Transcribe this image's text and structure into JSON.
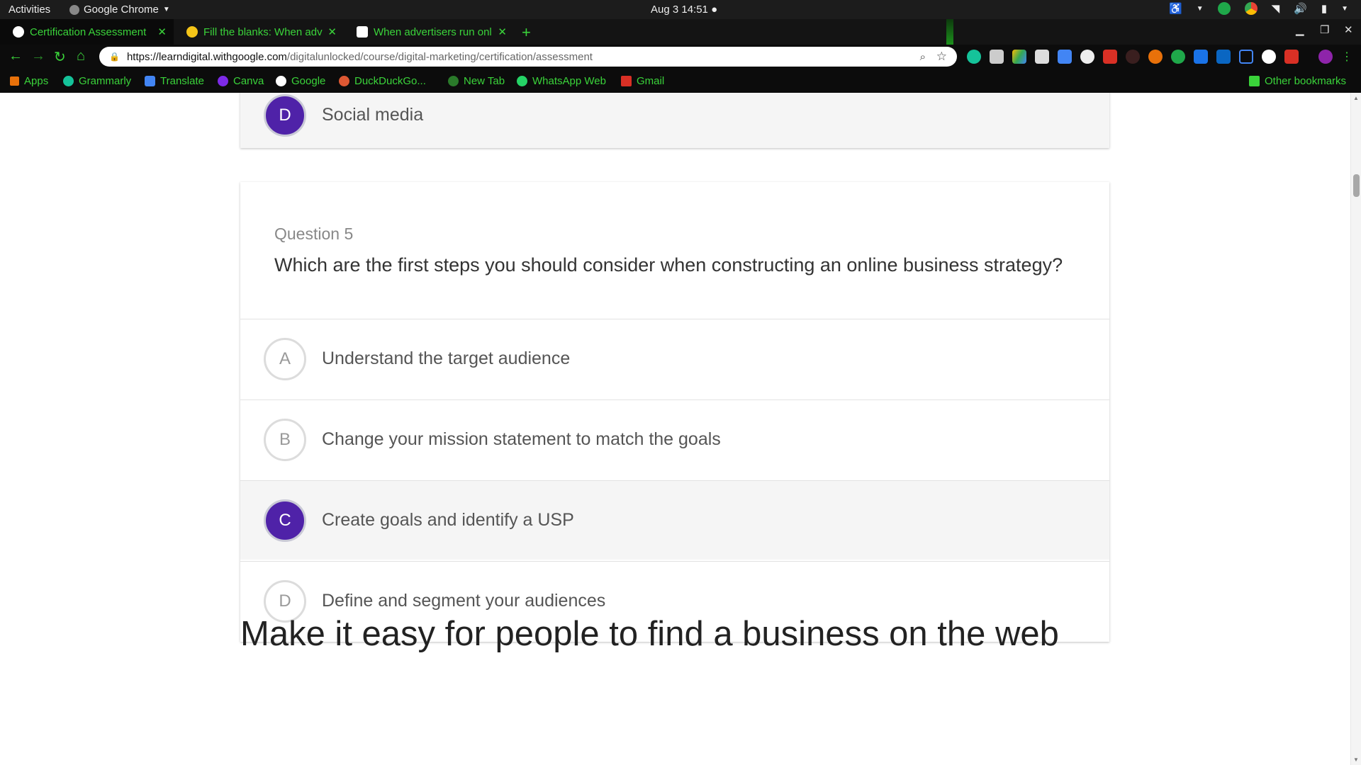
{
  "system_bar": {
    "activities": "Activities",
    "app_name": "Google Chrome",
    "datetime": "Aug 3  14:51"
  },
  "tabs": [
    {
      "title": "Certification Assessment",
      "active": true,
      "favicon": "google-icon"
    },
    {
      "title": "Fill the blanks: When adv",
      "active": false,
      "favicon": "bulb-icon"
    },
    {
      "title": "When advertisers run onl",
      "active": false,
      "favicon": "brainly-icon"
    }
  ],
  "address_bar": {
    "host": "https://learndigital.withgoogle.com",
    "path": "/digitalunlocked/course/digital-marketing/certification/assessment"
  },
  "bookmarks": [
    {
      "label": "Apps",
      "icon": "apps-grid-icon"
    },
    {
      "label": "Grammarly",
      "icon": "grammarly-icon"
    },
    {
      "label": "Translate",
      "icon": "translate-icon"
    },
    {
      "label": "Canva",
      "icon": "canva-icon"
    },
    {
      "label": "Google",
      "icon": "google-icon"
    },
    {
      "label": "DuckDuckGo...",
      "icon": "duckduckgo-icon"
    },
    {
      "label": "New Tab",
      "icon": "globe-icon"
    },
    {
      "label": "WhatsApp Web",
      "icon": "whatsapp-icon"
    },
    {
      "label": "Gmail",
      "icon": "gmail-icon"
    }
  ],
  "other_bookmarks": "Other bookmarks",
  "previous_question": {
    "options": [
      {
        "letter": "D",
        "text": "Social media",
        "selected": true
      }
    ]
  },
  "question": {
    "number_label": "Question 5",
    "text": "Which are the first steps you should consider when constructing an online business strategy?",
    "options": [
      {
        "letter": "A",
        "text": "Understand the target audience",
        "selected": false
      },
      {
        "letter": "B",
        "text": "Change your mission statement to match the goals",
        "selected": false
      },
      {
        "letter": "C",
        "text": "Create goals and identify a USP",
        "selected": true
      },
      {
        "letter": "D",
        "text": "Define and segment your audiences",
        "selected": false
      }
    ]
  },
  "next_section_heading": "Make it easy for people to find a business on the web",
  "colors": {
    "accent_purple": "#4f22a8",
    "chrome_theme_green": "#3ad33a"
  }
}
